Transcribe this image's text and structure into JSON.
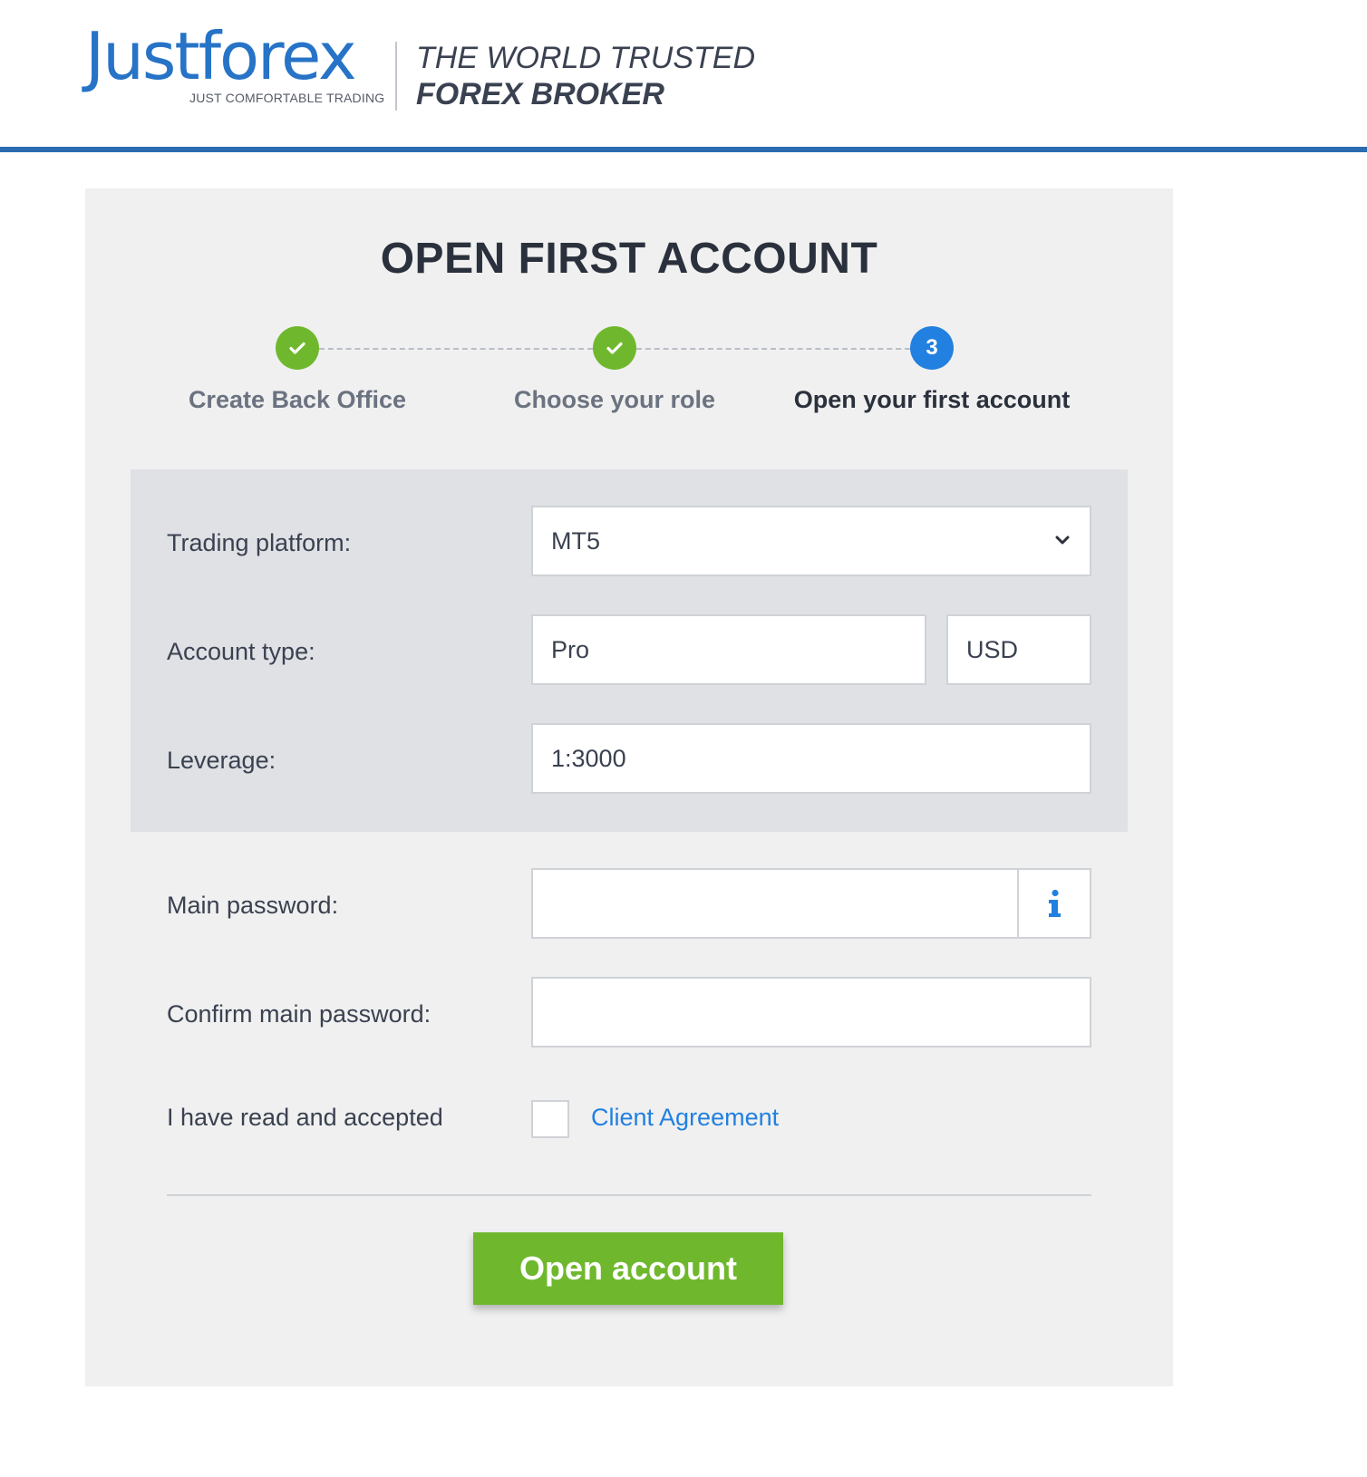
{
  "brand": {
    "name": "Justforex",
    "subtitle": "JUST COMFORTABLE TRADING",
    "tagline_line1": "THE WORLD TRUSTED",
    "tagline_line2": "FOREX BROKER",
    "primary_color": "#2673c7",
    "accent_green": "#6fb82d",
    "accent_blue": "#2280e0"
  },
  "page": {
    "title": "OPEN FIRST ACCOUNT"
  },
  "stepper": {
    "steps": [
      {
        "label": "Create Back Office",
        "status": "done",
        "icon": "check-icon"
      },
      {
        "label": "Choose your role",
        "status": "done",
        "icon": "check-icon"
      },
      {
        "label": "Open your first account",
        "status": "current",
        "number": "3"
      }
    ]
  },
  "form": {
    "trading_platform": {
      "label": "Trading platform:",
      "value": "MT5",
      "icon": "chevron-down-icon"
    },
    "account_type": {
      "label": "Account type:",
      "value": "Pro",
      "currency": "USD"
    },
    "leverage": {
      "label": "Leverage:",
      "value": "1:3000"
    },
    "main_password": {
      "label": "Main password:",
      "value": "",
      "icon": "info-icon"
    },
    "confirm_password": {
      "label": "Confirm main password:",
      "value": ""
    },
    "agreement": {
      "label": "I have read and accepted",
      "link_text": "Client Agreement",
      "checked": false
    },
    "submit_label": "Open account"
  }
}
